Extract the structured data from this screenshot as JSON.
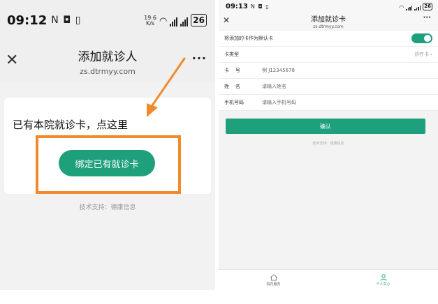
{
  "left": {
    "status": {
      "time": "09:12",
      "net_speed": "19.6",
      "net_unit": "K/s",
      "battery": "26"
    },
    "header": {
      "title": "添加就诊人",
      "subtitle": "zs.dtrmyy.com"
    },
    "prompt": "已有本院就诊卡，点这里",
    "bind_button": "绑定已有就诊卡",
    "footer": "技术支持：德康信息",
    "colors": {
      "accent": "#1ea07d",
      "highlight": "#f28a2b"
    }
  },
  "right": {
    "status": {
      "time": "09:13",
      "battery": "26"
    },
    "header": {
      "title": "添加就诊卡",
      "subtitle": "zs.dtrmyy.com"
    },
    "rows": {
      "default_card": {
        "label": "将添加的卡作为默认卡"
      },
      "card_type": {
        "label": "卡类型",
        "value": "诊疗卡"
      },
      "card_no": {
        "label": "卡    号",
        "placeholder": "例 J12345678"
      },
      "name": {
        "label": "姓    名",
        "placeholder": "请输入姓名"
      },
      "phone": {
        "label": "手机号码",
        "placeholder": "请输入手机号码"
      }
    },
    "confirm_button": "确认",
    "footer": "技术支持：德康信息",
    "tabbar": [
      {
        "label": "院内服务",
        "icon": "home-icon"
      },
      {
        "label": "个人中心",
        "icon": "person-icon"
      }
    ]
  }
}
